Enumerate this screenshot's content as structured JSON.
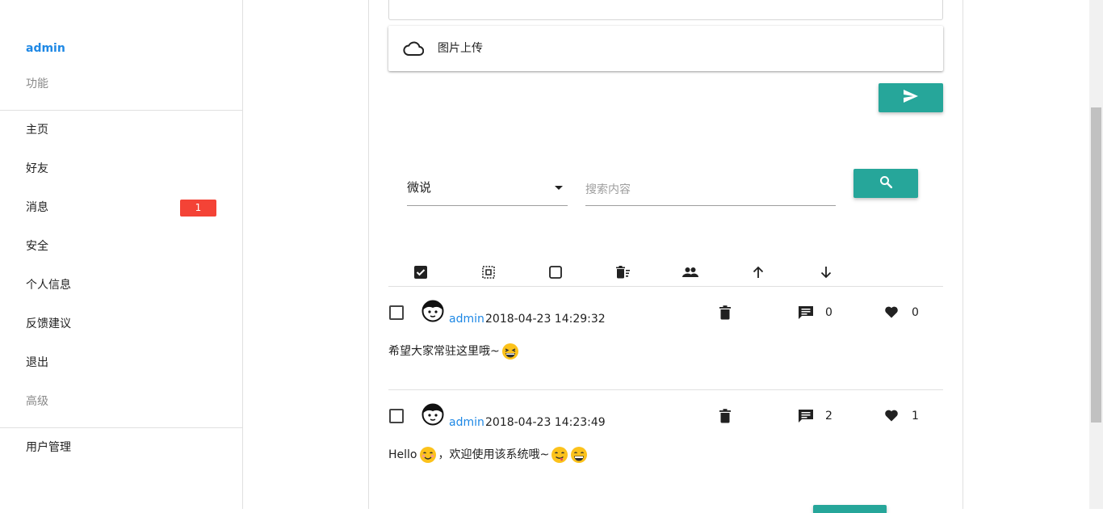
{
  "sidebar": {
    "user": "admin",
    "section_functions": "功能",
    "items": [
      {
        "label": "主页"
      },
      {
        "label": "好友"
      },
      {
        "label": "消息",
        "badge": "1"
      },
      {
        "label": "安全"
      },
      {
        "label": "个人信息"
      },
      {
        "label": "反馈建议"
      },
      {
        "label": "退出"
      }
    ],
    "section_advanced": "高级",
    "advanced_items": [
      {
        "label": "用户管理"
      }
    ]
  },
  "composer": {
    "upload_label": "图片上传",
    "send_icon": "send-icon"
  },
  "filter": {
    "selected_type": "微说",
    "search_placeholder": "搜索内容",
    "search_icon": "search-icon"
  },
  "toolbar": {
    "icons": [
      "select-all-icon",
      "select-inverse-icon",
      "deselect-icon",
      "delete-selected-icon",
      "group-icon",
      "sort-asc-icon",
      "sort-desc-icon"
    ]
  },
  "posts": [
    {
      "author": "admin",
      "time": "2018-04-23 14:29:32",
      "comments": "0",
      "likes": "0",
      "text": "希望大家常驻这里哦~"
    },
    {
      "author": "admin",
      "time": "2018-04-23 14:23:49",
      "comments": "2",
      "likes": "1",
      "text_a": "Hello",
      "text_b": "，欢迎使用该系统哦~"
    }
  ],
  "colors": {
    "accent": "#26a69a",
    "link": "#1e88e5",
    "badge": "#f44336"
  }
}
